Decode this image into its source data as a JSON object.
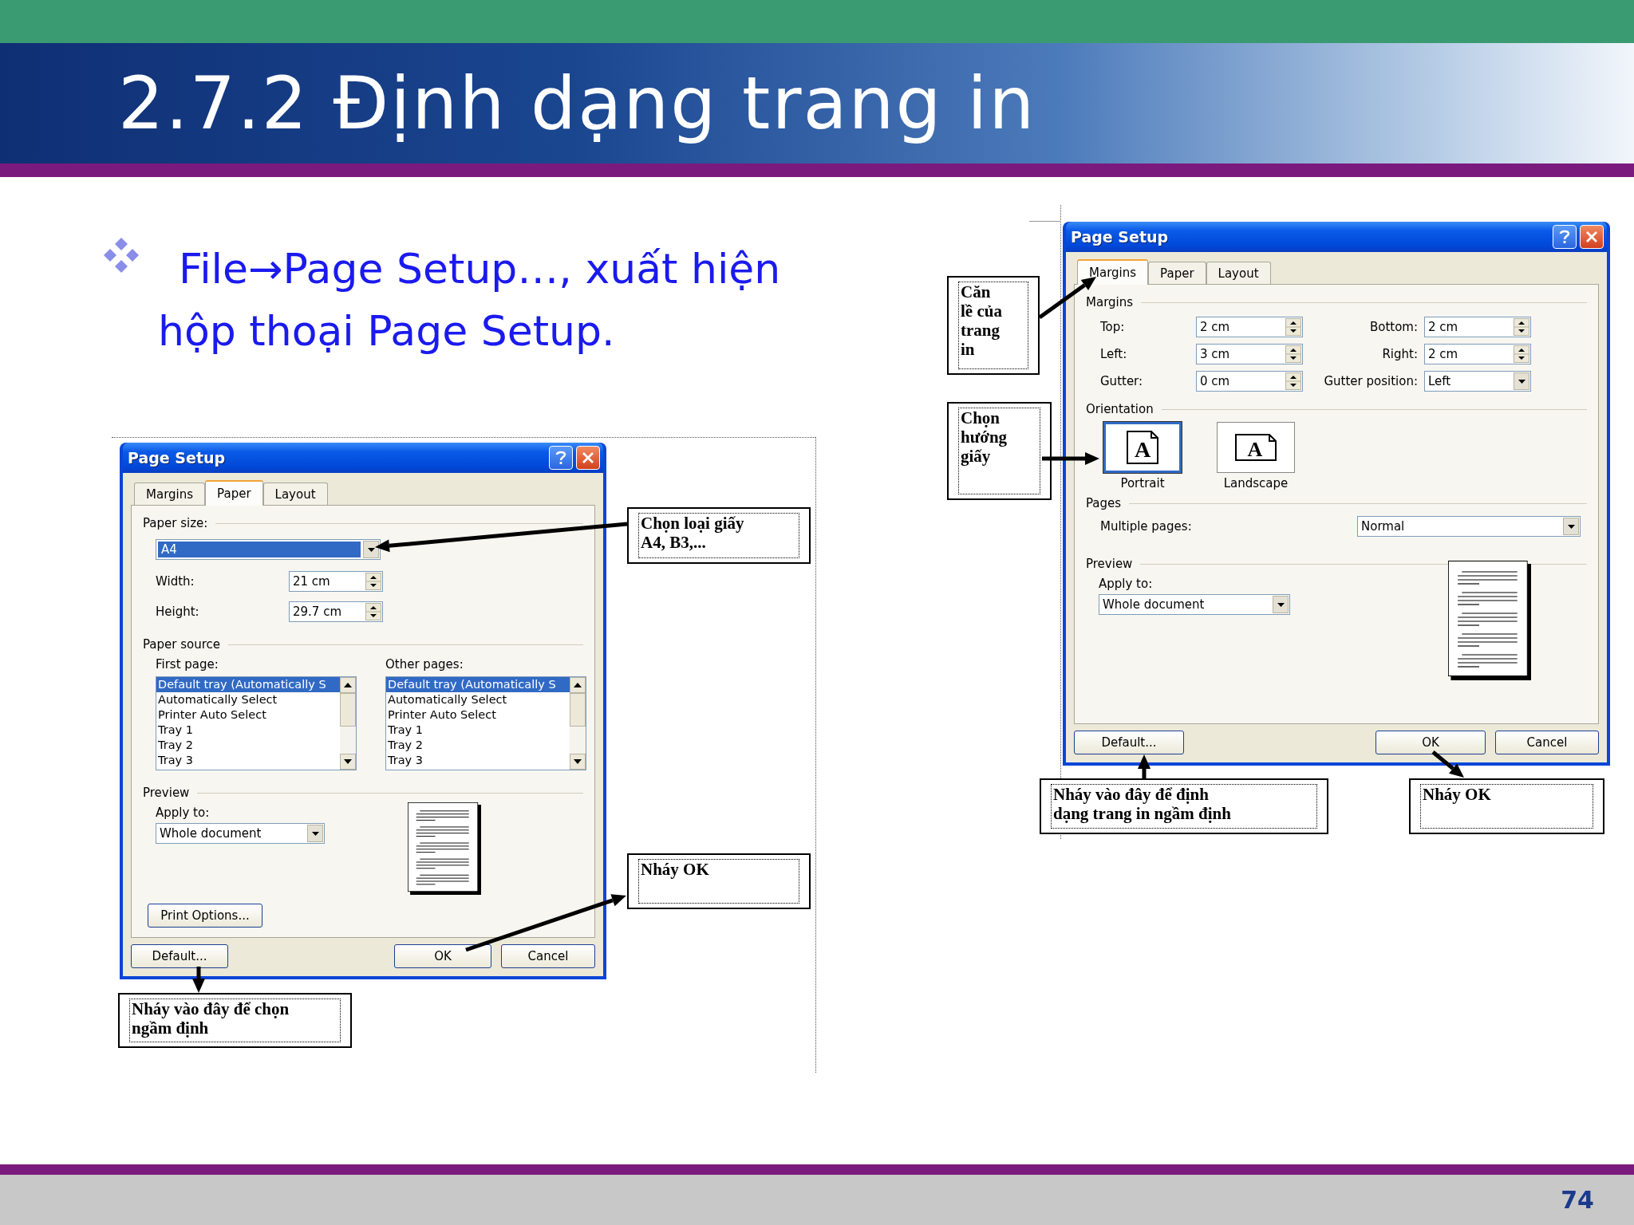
{
  "slide": {
    "title": "2.7.2 Định dạng trang in",
    "bullet": "File→Page Setup…, xuất hiện hộp thoại Page Setup.",
    "page_number": "74"
  },
  "paper_dialog": {
    "title": "Page Setup",
    "tabs": [
      {
        "label": "Margins",
        "selected": false
      },
      {
        "label": "Paper",
        "selected": true
      },
      {
        "label": "Layout",
        "selected": false
      }
    ],
    "paper_size": {
      "label": "Paper size:",
      "value": "A4",
      "selected": true
    },
    "width": {
      "label": "Width:",
      "value": "21 cm"
    },
    "height": {
      "label": "Height:",
      "value": "29.7 cm"
    },
    "paper_source": {
      "label": "Paper source",
      "lists": [
        {
          "label": "First page:",
          "items": [
            {
              "text": "Default tray (Automatically S",
              "selected": true
            },
            {
              "text": "Automatically Select",
              "selected": false
            },
            {
              "text": "Printer Auto Select",
              "selected": false
            },
            {
              "text": "Tray 1",
              "selected": false
            },
            {
              "text": "Tray 2",
              "selected": false
            },
            {
              "text": "Tray 3",
              "selected": false
            }
          ]
        },
        {
          "label": "Other pages:",
          "items": [
            {
              "text": "Default tray (Automatically S",
              "selected": true
            },
            {
              "text": "Automatically Select",
              "selected": false
            },
            {
              "text": "Printer Auto Select",
              "selected": false
            },
            {
              "text": "Tray 1",
              "selected": false
            },
            {
              "text": "Tray 2",
              "selected": false
            },
            {
              "text": "Tray 3",
              "selected": false
            }
          ]
        }
      ]
    },
    "preview": {
      "label": "Preview",
      "apply_to_label": "Apply to:",
      "apply_to": "Whole document"
    },
    "print_options": "Print Options...",
    "buttons": [
      "Default...",
      "OK",
      "Cancel"
    ]
  },
  "margins_dialog": {
    "title": "Page Setup",
    "tabs": [
      {
        "label": "Margins",
        "selected": true
      },
      {
        "label": "Paper",
        "selected": false
      },
      {
        "label": "Layout",
        "selected": false
      }
    ],
    "margins": {
      "label": "Margins",
      "fields": [
        {
          "label": "Top:",
          "value": "2 cm",
          "kind": "spin"
        },
        {
          "label": "Bottom:",
          "value": "2 cm",
          "kind": "spin"
        },
        {
          "label": "Left:",
          "value": "3 cm",
          "kind": "spin"
        },
        {
          "label": "Right:",
          "value": "2 cm",
          "kind": "spin"
        },
        {
          "label": "Gutter:",
          "value": "0 cm",
          "kind": "spin"
        },
        {
          "label": "Gutter position:",
          "value": "Left",
          "kind": "dropdown"
        }
      ]
    },
    "orientation": {
      "label": "Orientation",
      "options": [
        {
          "label": "Portrait",
          "glyph": "A",
          "selected": true
        },
        {
          "label": "Landscape",
          "glyph": "A",
          "selected": false
        }
      ]
    },
    "pages": {
      "label": "Pages",
      "multiple_pages_label": "Multiple pages:",
      "multiple_pages": "Normal"
    },
    "preview": {
      "label": "Preview",
      "apply_to_label": "Apply to:",
      "apply_to": "Whole document"
    },
    "buttons": [
      "Default...",
      "OK",
      "Cancel"
    ]
  },
  "callouts": [
    {
      "text": "Chọn loại giấy\nA4, B3,..."
    },
    {
      "text": "Nháy OK"
    },
    {
      "text": "Nháy vào đây để chọn\nngầm định"
    },
    {
      "text": "Căn\nlề của\ntrang\nin"
    },
    {
      "text": "Chọn\nhướng\ngiấy"
    },
    {
      "text": "Nháy vào đây để định\ndạng trang in ngầm định"
    },
    {
      "text": "Nháy OK"
    }
  ]
}
